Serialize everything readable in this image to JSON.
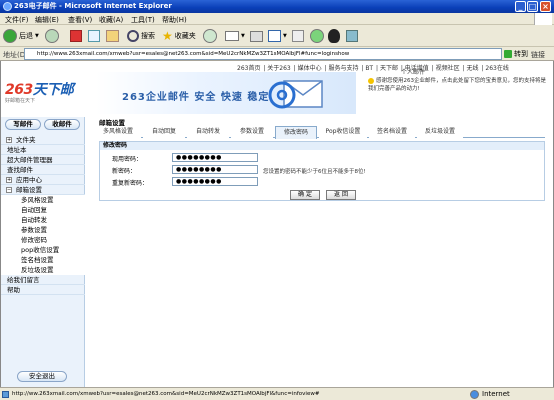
{
  "window": {
    "title": "263电子邮件 - Microsoft Internet Explorer"
  },
  "menu": [
    "文件(F)",
    "编辑(E)",
    "查看(V)",
    "收藏(A)",
    "工具(T)",
    "帮助(H)"
  ],
  "toolbar": {
    "back": "后退",
    "search": "搜索",
    "favorites": "收藏夹"
  },
  "address": {
    "label": "地址(D)",
    "url": "http://www.263xmail.com/xmweb?usr=esales@net263.com&sid=MeU2crNkMZw3ZT1sMOAlbjFl#func=loginshow",
    "go": "转到",
    "links": "链接"
  },
  "top_links": [
    "263首页",
    "关于263",
    "媒体中心",
    "服务与支持",
    "BT",
    "天下邮",
    "电话增值",
    "视频社区",
    "无线",
    "263在线"
  ],
  "logo": {
    "brand_a": "263",
    "brand_b": "天下邮",
    "tagline": "好邮箱在天下"
  },
  "banner": {
    "slogan": "263企业邮件  安全 快速 稳定"
  },
  "notice": {
    "center": "个人邮件",
    "text": "感谢您使用263企业邮件，点击此处留下您的宝贵意见，您的支持将是我们完善产品的动力!"
  },
  "sidebar": {
    "write_btn": "写邮件",
    "receive_btn": "收邮件",
    "items": [
      {
        "label": "文件夹",
        "type": "plus"
      },
      {
        "label": "地址本",
        "type": "plain"
      },
      {
        "label": "超大邮件管理器",
        "type": "plain"
      },
      {
        "label": "查找邮件",
        "type": "plain"
      },
      {
        "label": "应用中心",
        "type": "plus"
      },
      {
        "label": "邮箱设置",
        "type": "minus"
      },
      {
        "label": "多风格设置",
        "type": "sub"
      },
      {
        "label": "自动回复",
        "type": "sub"
      },
      {
        "label": "自动转发",
        "type": "sub"
      },
      {
        "label": "参数设置",
        "type": "sub"
      },
      {
        "label": "修改密码",
        "type": "sub"
      },
      {
        "label": "pop收信设置",
        "type": "sub"
      },
      {
        "label": "签名档设置",
        "type": "sub"
      },
      {
        "label": "反垃圾设置",
        "type": "sub"
      },
      {
        "label": "给我们留言",
        "type": "plain"
      },
      {
        "label": "帮助",
        "type": "plain"
      }
    ],
    "logout": "安全退出"
  },
  "main": {
    "crumb": "邮箱设置",
    "tabs": [
      "多风格设置",
      "自动回复",
      "自动转发",
      "参数设置",
      "修改密码",
      "Pop收信设置",
      "签名档设置",
      "反垃圾设置"
    ],
    "active_tab": 4,
    "panel_title": "修改密码",
    "fields": [
      {
        "label": "现用密码：",
        "value": "●●●●●●●●"
      },
      {
        "label": "新密码：",
        "value": "●●●●●●●●"
      },
      {
        "label": "重复新密码：",
        "value": "●●●●●●●●"
      }
    ],
    "note": "您设置的密码不能少于6位且不能多于8位!",
    "ok": "确  定",
    "back": "返  回"
  },
  "status": {
    "url": "http://ww.263xmail.com/xmweb?usr=esales@net263.com&sid=MeU2crNkMZw3ZT1sMOAlbjFl&func=infoview#",
    "zone": "Internet"
  },
  "colors": {
    "titlebar": "#0a3fb8",
    "sidebar": "#eaf2fb",
    "accent": "#1b5fb4"
  }
}
